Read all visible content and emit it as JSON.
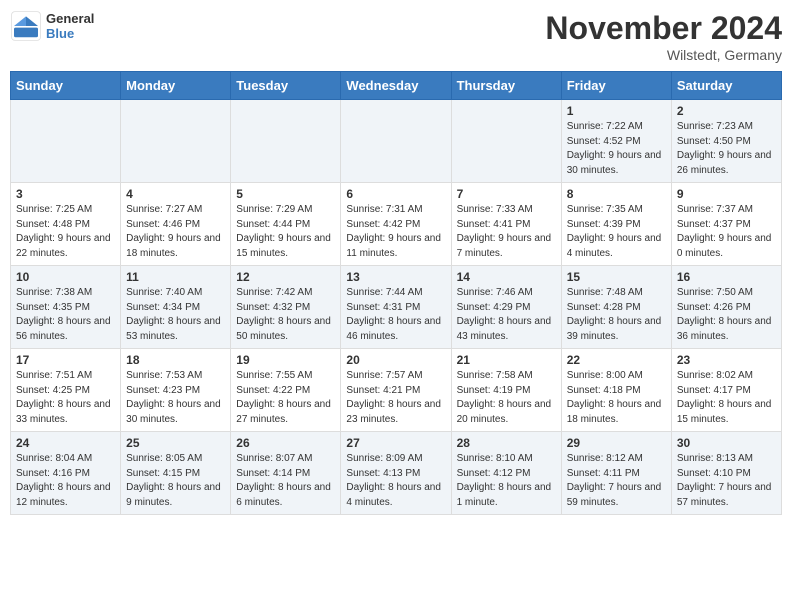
{
  "header": {
    "logo_general": "General",
    "logo_blue": "Blue",
    "month_title": "November 2024",
    "location": "Wilstedt, Germany"
  },
  "days_of_week": [
    "Sunday",
    "Monday",
    "Tuesday",
    "Wednesday",
    "Thursday",
    "Friday",
    "Saturday"
  ],
  "weeks": [
    [
      {
        "day": "",
        "info": ""
      },
      {
        "day": "",
        "info": ""
      },
      {
        "day": "",
        "info": ""
      },
      {
        "day": "",
        "info": ""
      },
      {
        "day": "",
        "info": ""
      },
      {
        "day": "1",
        "info": "Sunrise: 7:22 AM\nSunset: 4:52 PM\nDaylight: 9 hours and 30 minutes."
      },
      {
        "day": "2",
        "info": "Sunrise: 7:23 AM\nSunset: 4:50 PM\nDaylight: 9 hours and 26 minutes."
      }
    ],
    [
      {
        "day": "3",
        "info": "Sunrise: 7:25 AM\nSunset: 4:48 PM\nDaylight: 9 hours and 22 minutes."
      },
      {
        "day": "4",
        "info": "Sunrise: 7:27 AM\nSunset: 4:46 PM\nDaylight: 9 hours and 18 minutes."
      },
      {
        "day": "5",
        "info": "Sunrise: 7:29 AM\nSunset: 4:44 PM\nDaylight: 9 hours and 15 minutes."
      },
      {
        "day": "6",
        "info": "Sunrise: 7:31 AM\nSunset: 4:42 PM\nDaylight: 9 hours and 11 minutes."
      },
      {
        "day": "7",
        "info": "Sunrise: 7:33 AM\nSunset: 4:41 PM\nDaylight: 9 hours and 7 minutes."
      },
      {
        "day": "8",
        "info": "Sunrise: 7:35 AM\nSunset: 4:39 PM\nDaylight: 9 hours and 4 minutes."
      },
      {
        "day": "9",
        "info": "Sunrise: 7:37 AM\nSunset: 4:37 PM\nDaylight: 9 hours and 0 minutes."
      }
    ],
    [
      {
        "day": "10",
        "info": "Sunrise: 7:38 AM\nSunset: 4:35 PM\nDaylight: 8 hours and 56 minutes."
      },
      {
        "day": "11",
        "info": "Sunrise: 7:40 AM\nSunset: 4:34 PM\nDaylight: 8 hours and 53 minutes."
      },
      {
        "day": "12",
        "info": "Sunrise: 7:42 AM\nSunset: 4:32 PM\nDaylight: 8 hours and 50 minutes."
      },
      {
        "day": "13",
        "info": "Sunrise: 7:44 AM\nSunset: 4:31 PM\nDaylight: 8 hours and 46 minutes."
      },
      {
        "day": "14",
        "info": "Sunrise: 7:46 AM\nSunset: 4:29 PM\nDaylight: 8 hours and 43 minutes."
      },
      {
        "day": "15",
        "info": "Sunrise: 7:48 AM\nSunset: 4:28 PM\nDaylight: 8 hours and 39 minutes."
      },
      {
        "day": "16",
        "info": "Sunrise: 7:50 AM\nSunset: 4:26 PM\nDaylight: 8 hours and 36 minutes."
      }
    ],
    [
      {
        "day": "17",
        "info": "Sunrise: 7:51 AM\nSunset: 4:25 PM\nDaylight: 8 hours and 33 minutes."
      },
      {
        "day": "18",
        "info": "Sunrise: 7:53 AM\nSunset: 4:23 PM\nDaylight: 8 hours and 30 minutes."
      },
      {
        "day": "19",
        "info": "Sunrise: 7:55 AM\nSunset: 4:22 PM\nDaylight: 8 hours and 27 minutes."
      },
      {
        "day": "20",
        "info": "Sunrise: 7:57 AM\nSunset: 4:21 PM\nDaylight: 8 hours and 23 minutes."
      },
      {
        "day": "21",
        "info": "Sunrise: 7:58 AM\nSunset: 4:19 PM\nDaylight: 8 hours and 20 minutes."
      },
      {
        "day": "22",
        "info": "Sunrise: 8:00 AM\nSunset: 4:18 PM\nDaylight: 8 hours and 18 minutes."
      },
      {
        "day": "23",
        "info": "Sunrise: 8:02 AM\nSunset: 4:17 PM\nDaylight: 8 hours and 15 minutes."
      }
    ],
    [
      {
        "day": "24",
        "info": "Sunrise: 8:04 AM\nSunset: 4:16 PM\nDaylight: 8 hours and 12 minutes."
      },
      {
        "day": "25",
        "info": "Sunrise: 8:05 AM\nSunset: 4:15 PM\nDaylight: 8 hours and 9 minutes."
      },
      {
        "day": "26",
        "info": "Sunrise: 8:07 AM\nSunset: 4:14 PM\nDaylight: 8 hours and 6 minutes."
      },
      {
        "day": "27",
        "info": "Sunrise: 8:09 AM\nSunset: 4:13 PM\nDaylight: 8 hours and 4 minutes."
      },
      {
        "day": "28",
        "info": "Sunrise: 8:10 AM\nSunset: 4:12 PM\nDaylight: 8 hours and 1 minute."
      },
      {
        "day": "29",
        "info": "Sunrise: 8:12 AM\nSunset: 4:11 PM\nDaylight: 7 hours and 59 minutes."
      },
      {
        "day": "30",
        "info": "Sunrise: 8:13 AM\nSunset: 4:10 PM\nDaylight: 7 hours and 57 minutes."
      }
    ]
  ]
}
